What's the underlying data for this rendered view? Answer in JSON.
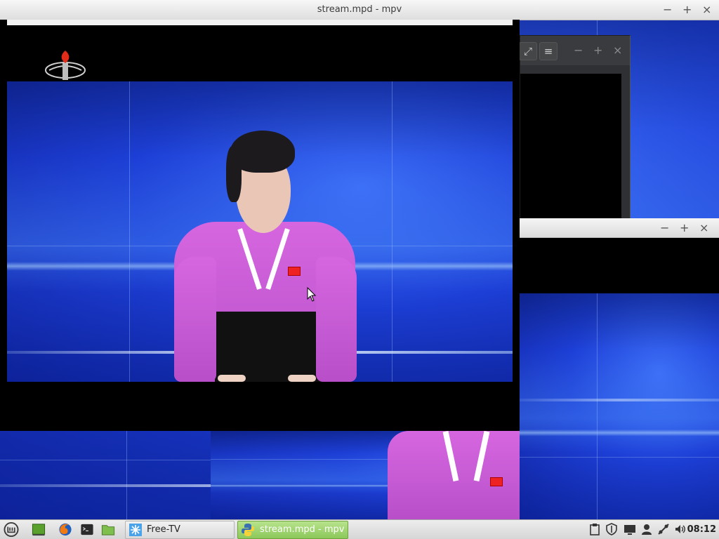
{
  "window": {
    "title": "stream.mpd - mpv",
    "minimize": "−",
    "maximize": "+",
    "close": "×"
  },
  "bg_window_top": {
    "fullscreen_icon": "expand-icon",
    "menu_icon": "hamburger-menu-icon",
    "minimize": "−",
    "maximize": "+",
    "close": "×"
  },
  "bg_window_bottom": {
    "minimize": "−",
    "maximize": "+",
    "close": "×"
  },
  "taskbar": {
    "menu_icon": "mint-menu-icon",
    "launchers": [
      "show-desktop-icon",
      "firefox-icon",
      "terminal-icon",
      "files-icon"
    ],
    "tasks": [
      {
        "label": "Free-TV",
        "icon": "free-tv-icon",
        "active": false
      },
      {
        "label": "stream.mpd - mpv",
        "icon": "python-icon",
        "active": true
      }
    ],
    "tray": [
      "clipboard-icon",
      "shield-icon",
      "display-icon",
      "user-icon",
      "network-icon",
      "volume-icon"
    ],
    "clock": "08:12"
  },
  "colors": {
    "video_blue": "#1d3fd6",
    "dress_pink": "#c45ad3",
    "active_task_green": "#9bd36b"
  }
}
